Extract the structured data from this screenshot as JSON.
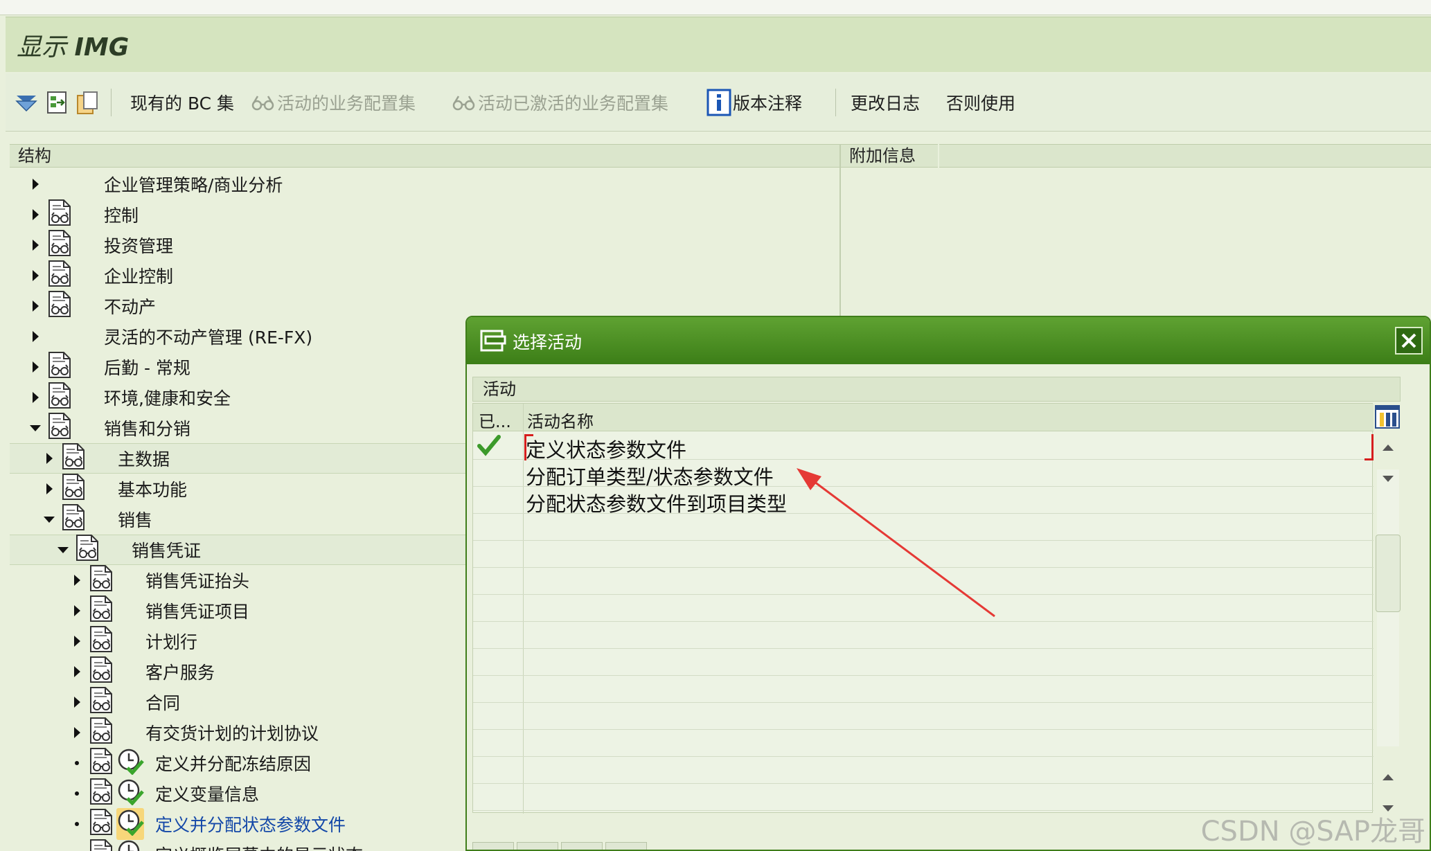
{
  "window": {
    "title_prefix": "显示",
    "title_bold": "IMG"
  },
  "toolbar": {
    "bc_sets_label": "现有的 BC 集",
    "active_bc_sets_label": "活动的业务配置集",
    "activated_bc_sets_label": "活动已激活的业务配置集",
    "release_notes_label": "版本注释",
    "change_log_label": "更改日志",
    "otherwise_label": "否则使用"
  },
  "panels": {
    "structure_label": "结构",
    "additional_info_label": "附加信息"
  },
  "tree": {
    "items": [
      {
        "label": "企业管理策略/商业分析",
        "state": "collapsed",
        "doc": false
      },
      {
        "label": "控制",
        "state": "collapsed",
        "doc": true
      },
      {
        "label": "投资管理",
        "state": "collapsed",
        "doc": true
      },
      {
        "label": "企业控制",
        "state": "collapsed",
        "doc": true
      },
      {
        "label": "不动产",
        "state": "collapsed",
        "doc": true
      },
      {
        "label": "灵活的不动产管理 (RE-FX)",
        "state": "collapsed",
        "doc": false
      },
      {
        "label": "后勤 - 常规",
        "state": "collapsed",
        "doc": true
      },
      {
        "label": "环境,健康和安全",
        "state": "collapsed",
        "doc": true
      },
      {
        "label": "销售和分销",
        "state": "expanded",
        "doc": true
      },
      {
        "label": "主数据",
        "state": "collapsed",
        "doc": true
      },
      {
        "label": "基本功能",
        "state": "collapsed",
        "doc": true
      },
      {
        "label": "销售",
        "state": "expanded",
        "doc": true
      },
      {
        "label": "销售凭证",
        "state": "expanded",
        "doc": true
      },
      {
        "label": "销售凭证抬头",
        "state": "collapsed",
        "doc": true
      },
      {
        "label": "销售凭证项目",
        "state": "collapsed",
        "doc": true
      },
      {
        "label": "计划行",
        "state": "collapsed",
        "doc": true
      },
      {
        "label": "客户服务",
        "state": "collapsed",
        "doc": true
      },
      {
        "label": "合同",
        "state": "collapsed",
        "doc": true
      },
      {
        "label": "有交货计划的计划协议",
        "state": "collapsed",
        "doc": true
      },
      {
        "label": "定义并分配冻结原因",
        "state": "leaf",
        "doc": true
      },
      {
        "label": "定义变量信息",
        "state": "leaf",
        "doc": true
      },
      {
        "label": "定义并分配状态参数文件",
        "state": "leaf",
        "doc": true
      },
      {
        "label": "定义概览屏幕中的显示状态",
        "state": "leaf",
        "doc": true
      }
    ]
  },
  "dialog": {
    "title": "选择活动",
    "box_label": "活动",
    "col_done": "已...",
    "col_name": "活动名称",
    "rows": [
      {
        "name": "定义状态参数文件",
        "done": true
      },
      {
        "name": "分配订单类型/状态参数文件",
        "done": false
      },
      {
        "name": "分配状态参数文件到项目类型",
        "done": false
      }
    ]
  },
  "watermark": "CSDN @SAP龙哥",
  "colors": {
    "title_bg": "#d5e4bf",
    "dialog_title": "#4b8f24",
    "annotation_arrow": "#e53935",
    "selected_text": "#1448a8"
  }
}
